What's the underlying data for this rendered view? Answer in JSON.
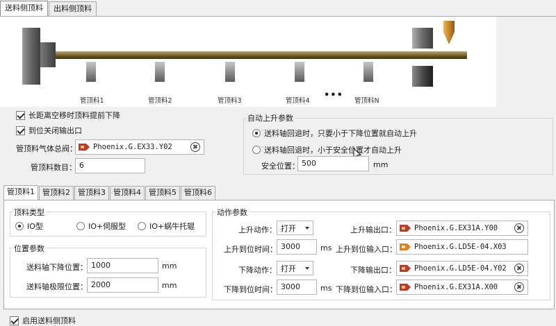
{
  "tabs": {
    "feed_side": "送料侧顶料",
    "discharge_side": "出料侧顶料"
  },
  "diagram": {
    "labels": [
      "管顶料1",
      "管顶料2",
      "管顶料3",
      "管顶料4",
      "管顶料N"
    ],
    "ellipsis": "•••"
  },
  "options": {
    "long_distance_lower": "长距离空移时顶料提前下降",
    "close_output": "到位关闭输出口",
    "gas_valve_label": "管顶料气体总阀：",
    "gas_valve_value": "Phoenix.G.EX33.Y02",
    "count_label": "管顶料数目：",
    "count_value": "6"
  },
  "auto_lift": {
    "title": "自动上升参数",
    "radio1": "送料轴回退时，只要小于下降位置就自动上升",
    "radio2": "送料轴回退时，小于安全位置才自动上升",
    "safe_label": "安全位置：",
    "safe_value": "500",
    "safe_unit": "mm"
  },
  "inner_tabs": [
    "管顶料1",
    "管顶料2",
    "管顶料3",
    "管顶料4",
    "管顶料5",
    "管顶料6"
  ],
  "type_group": {
    "title": "顶料类型",
    "opt1": "IO型",
    "opt2": "IO+伺服型",
    "opt3": "IO+蜗牛托辊"
  },
  "position_group": {
    "title": "位置参数",
    "lower_label": "送料轴下降位置：",
    "lower_value": "1000",
    "limit_label": "送料轴极限位置：",
    "limit_value": "2000",
    "unit": "mm"
  },
  "action_group": {
    "title": "动作参数",
    "up_action_label": "上升动作：",
    "up_action_value": "打开",
    "up_time_label": "上升到位时间：",
    "up_time_value": "3000",
    "down_action_label": "下降动作：",
    "down_action_value": "打开",
    "down_time_label": "下降到位时间：",
    "down_time_value": "3000",
    "time_unit": "ms",
    "up_output_label": "上升输出口：",
    "up_output_value": "Phoenix.G.EX31A.Y00",
    "up_input_label": "上升到位输入口：",
    "up_input_value": "Phoenix.G.LD5E-04.X03",
    "down_output_label": "下降输出口：",
    "down_output_value": "Phoenix.G.LD5E-04.Y02",
    "down_input_label": "下降到位输入口：",
    "down_input_value": "Phoenix.G.EX31A.X00"
  },
  "footer": {
    "enable_label": "启用送料侧顶料"
  },
  "colors": {
    "output_icon": "#c0392b",
    "input_icon": "#e67e22",
    "rod": "#6b5a2a",
    "nozzle": "#d4a04a"
  }
}
